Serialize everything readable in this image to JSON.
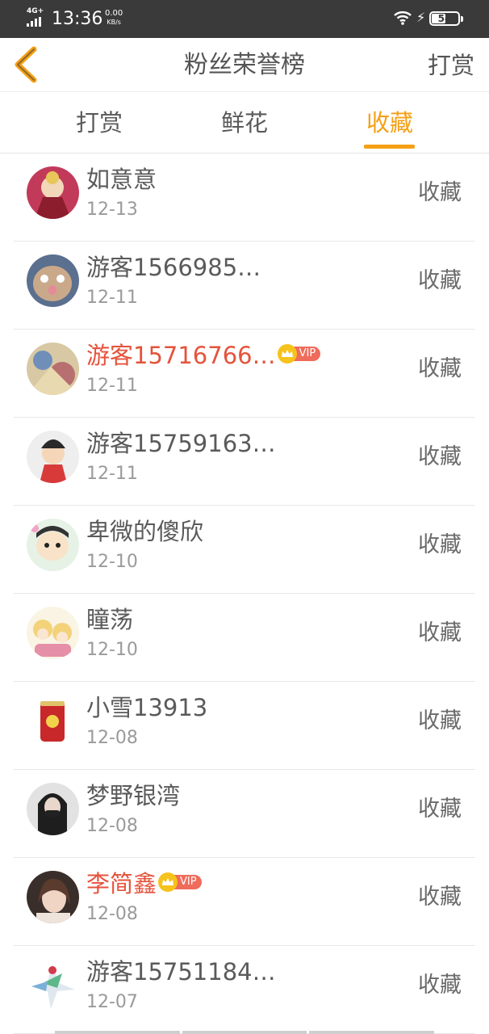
{
  "status_bar": {
    "network": "4G+",
    "time": "13:36",
    "speed_value": "0.00",
    "speed_unit": "KB/s",
    "battery": "54",
    "battery_level": 0.54
  },
  "nav": {
    "back_icon": "chevron-left-icon",
    "title": "粉丝荣誉榜",
    "action": "打赏"
  },
  "tabs": [
    {
      "label": "打赏",
      "active": false
    },
    {
      "label": "鲜花",
      "active": false
    },
    {
      "label": "收藏",
      "active": true
    }
  ],
  "accent_color": "#f5a015",
  "vip_name_color": "#e5533c",
  "vip_label": "VIP",
  "rows": [
    {
      "name": "如意意",
      "date": "12-13",
      "action": "收藏",
      "vip": false
    },
    {
      "name": "游客1566985…",
      "date": "12-11",
      "action": "收藏",
      "vip": false
    },
    {
      "name": "游客15716766…",
      "date": "12-11",
      "action": "收藏",
      "vip": true
    },
    {
      "name": "游客15759163…",
      "date": "12-11",
      "action": "收藏",
      "vip": false
    },
    {
      "name": "卑微的傻欣",
      "date": "12-10",
      "action": "收藏",
      "vip": false
    },
    {
      "name": "瞳荡",
      "date": "12-10",
      "action": "收藏",
      "vip": false
    },
    {
      "name": "小雪13913",
      "date": "12-08",
      "action": "收藏",
      "vip": false
    },
    {
      "name": "梦野银湾",
      "date": "12-08",
      "action": "收藏",
      "vip": false
    },
    {
      "name": "李简鑫",
      "date": "12-08",
      "action": "收藏",
      "vip": true
    },
    {
      "name": "游客15751184…",
      "date": "12-07",
      "action": "收藏",
      "vip": false
    }
  ]
}
